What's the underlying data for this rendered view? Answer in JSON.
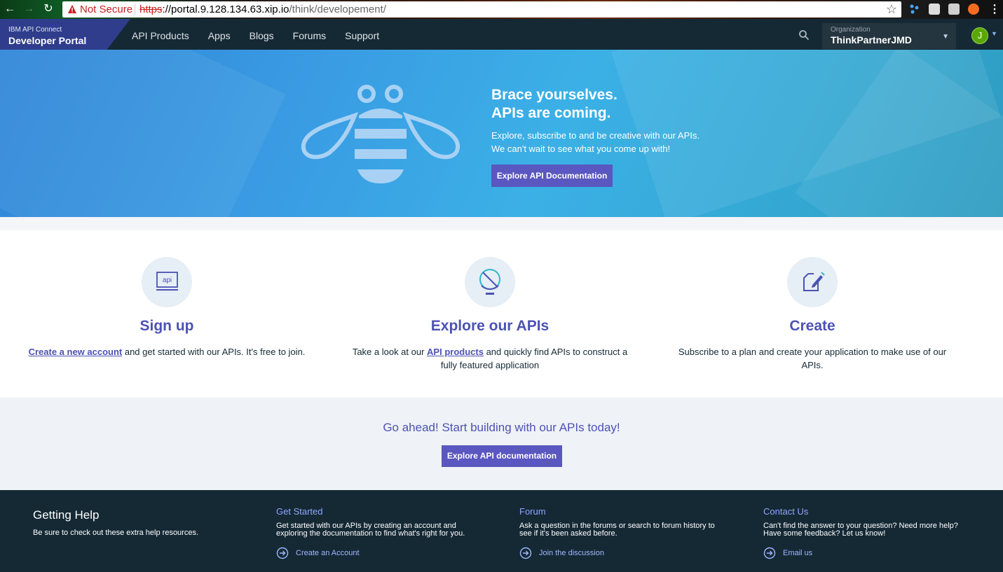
{
  "browser": {
    "security_label": "Not Secure",
    "url_scheme": "https",
    "url_host": "://portal.9.128.134.63.xip.io",
    "url_path": "/think/developement/"
  },
  "brand": {
    "small": "IBM API Connect",
    "big": "Developer Portal"
  },
  "nav": {
    "items": [
      "API Products",
      "Apps",
      "Blogs",
      "Forums",
      "Support"
    ]
  },
  "org": {
    "label": "Organization",
    "value": "ThinkPartnerJMD"
  },
  "user": {
    "avatar_initial": "J"
  },
  "hero": {
    "title_line1": "Brace yourselves.",
    "title_line2": "APIs are coming.",
    "sub_line1": "Explore, subscribe to and be creative with our APIs.",
    "sub_line2": "We can't wait to see what you come up with!",
    "button": "Explore API Documentation"
  },
  "features": [
    {
      "icon": "api-screen-icon",
      "title": "Sign up",
      "link_text": "Create a new account",
      "text_after": " and get started with our APIs. It's free to join."
    },
    {
      "icon": "globe-icon",
      "title": "Explore our APIs",
      "text_before": "Take a look at our ",
      "link_text": "API products",
      "text_after": " and quickly find APIs to construct a fully featured application"
    },
    {
      "icon": "edit-document-icon",
      "title": "Create",
      "text": "Subscribe to a plan and create your application to make use of our APIs."
    }
  ],
  "cta": {
    "heading": "Go ahead! Start building with our APIs today!",
    "button": "Explore API documentation"
  },
  "footer": {
    "help": {
      "title": "Getting Help",
      "text": "Be sure to check out these extra help resources."
    },
    "columns": [
      {
        "title": "Get Started",
        "text": "Get started with our APIs by creating an account and exploring the documentation to find what's right for you.",
        "link": "Create an Account"
      },
      {
        "title": "Forum",
        "text": "Ask a question in the forums or search to forum history to see if it's been asked before.",
        "link": "Join the discussion"
      },
      {
        "title": "Contact Us",
        "text": "Can't find the answer to your question? Need more help? Have some feedback? Let us know!",
        "link": "Email us"
      }
    ]
  },
  "colors": {
    "accent": "#5a57c0",
    "heading_purple": "#4c52b4",
    "dark_nav": "#152935",
    "hero_blue": "#3a9be3"
  }
}
